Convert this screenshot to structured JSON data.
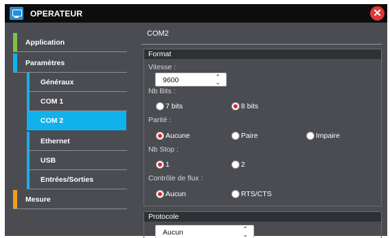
{
  "window": {
    "title": "OPERATEUR"
  },
  "sidebar": {
    "items": [
      {
        "label": "Application",
        "color": "#7cc242"
      },
      {
        "label": "Paramètres",
        "color": "#11b2ec"
      },
      {
        "label": "Généraux"
      },
      {
        "label": "COM 1"
      },
      {
        "label": "COM 2",
        "selected": true
      },
      {
        "label": "Ethernet"
      },
      {
        "label": "USB"
      },
      {
        "label": "Entrées/Sorties"
      },
      {
        "label": "Mesure",
        "color": "#f0a01e"
      }
    ]
  },
  "main": {
    "page_title": "COM2",
    "format": {
      "header": "Format",
      "vitesse": {
        "label": "Vitesse :",
        "value": "9600"
      },
      "nb_bits": {
        "label": "Nb Bits :",
        "options": [
          "7 bits",
          "8 bits"
        ],
        "selected": "8 bits"
      },
      "parite": {
        "label": "Parité :",
        "options": [
          "Aucune",
          "Paire",
          "Impaire"
        ],
        "selected": "Aucune"
      },
      "nb_stop": {
        "label": "Nb Stop :",
        "options": [
          "1",
          "2"
        ],
        "selected": "1"
      },
      "controle": {
        "label": "Contrôle de flux :",
        "options": [
          "Aucun",
          "RTS/CTS"
        ],
        "selected": "Aucun"
      }
    },
    "protocole": {
      "header": "Protocole",
      "value": "Aucun"
    }
  },
  "colors": {
    "accent": "#11b2ec",
    "radio_checked": "#e0252f",
    "close": "#e23535"
  }
}
